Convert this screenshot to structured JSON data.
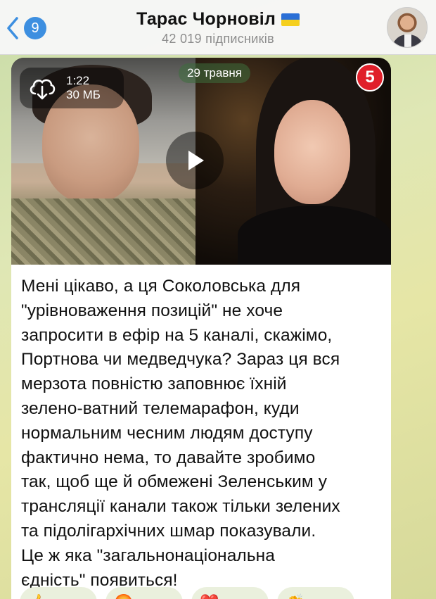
{
  "header": {
    "back_count": "9",
    "title": "Тарас Чорновіл",
    "subscribers": "42 019 підписників"
  },
  "video": {
    "duration": "1:22",
    "size": "30 МБ",
    "date": "29 травня",
    "channel_badge": "5"
  },
  "message": {
    "lines": [
      "Мені цікаво, а ця Соколовська для",
      "\"урівноваження позицій\" не хоче",
      "запросити в ефір на 5 каналі, скажімо,",
      "Портнова чи медведчука? Зараз ця вся",
      "мерзота повністю заповнює їхній",
      "зелено-ватний телемарафон, куди",
      "нормальним чесним людям доступу",
      "фактично нема, то давайте зробимо",
      "так, щоб ще й обмежені Зеленським у",
      "трансляції канали також тільки зелених",
      "та підолігархічних шмар показували.",
      "Це ж яка \"загальнонаціональна",
      "єдність\" появиться!"
    ]
  },
  "reactions": [
    {
      "emoji": "👍"
    },
    {
      "emoji": "🤬"
    },
    {
      "emoji": "❤️"
    },
    {
      "emoji": "👏"
    }
  ],
  "colors": {
    "accent": "#3d8fe0",
    "flag_blue": "#2a6fd6",
    "flag_yellow": "#f5cf1d"
  }
}
